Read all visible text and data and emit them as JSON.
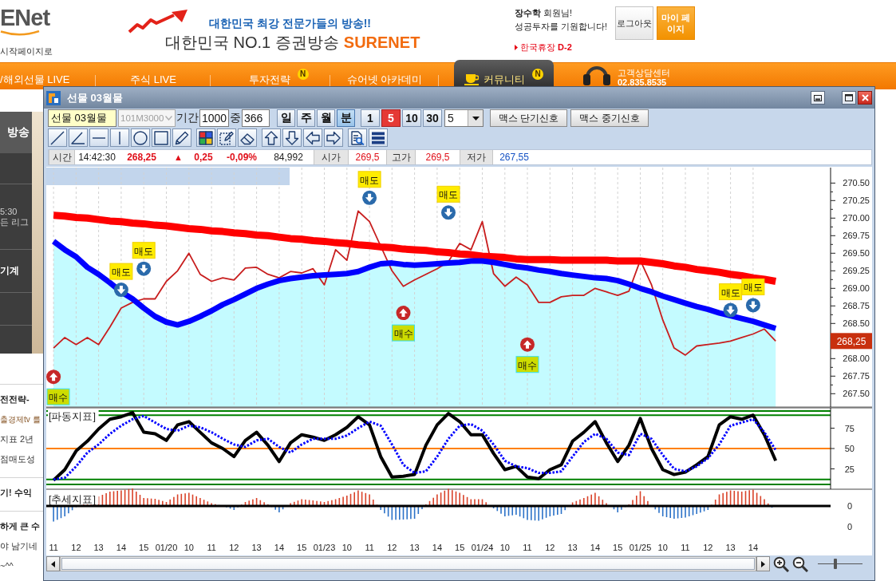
{
  "header": {
    "logo": "ENet",
    "start_page_link": "시작페이지로",
    "tagline": "대한민국 최강 전문가들의 방송!!",
    "title": "대한민국 NO.1 증권방송",
    "brand": "SURENET",
    "greeting": "**장수학** 회원님!",
    "wish": "성공투자를 기원합니다!",
    "notice": "한국휴장 **D-2**",
    "logout_button": "로그아웃",
    "mypage_button": "마이 페이지"
  },
  "nav": {
    "items": [
      {
        "label": "/해외선물 LIVE",
        "selected": false
      },
      {
        "label": "주식 LIVE",
        "selected": false
      },
      {
        "label": "투자전략",
        "badge": "N",
        "selected": false
      },
      {
        "label": "슈어넷 아카데미",
        "selected": false
      },
      {
        "label": "커뮤니티",
        "badge": "N",
        "selected": true
      }
    ],
    "support_title": "고객상담센터",
    "support_phone": "02.835.8535"
  },
  "side": {
    "heading": "방송",
    "entries": [
      {
        "kind": "text",
        "lines": [
          "5:30",
          "든 리그"
        ]
      },
      {
        "kind": "title",
        "lines": [
          "기계"
        ]
      }
    ],
    "news": [
      {
        "kind": "title",
        "text": "전전략-"
      },
      {
        "kind": "source",
        "text": "출경제tv 를"
      },
      {
        "kind": "text",
        "text": "지표 2년"
      },
      {
        "kind": "text",
        "text": "점매도성"
      },
      {
        "kind": "title",
        "text": "기! 수익"
      },
      {
        "kind": "title",
        "text": "하게 큰 수"
      },
      {
        "kind": "text",
        "text": "야 남기네"
      },
      {
        "kind": "text",
        "text": "~^^"
      }
    ]
  },
  "chart_window": {
    "title": "선물 03월물",
    "symbol": "선물 03월물",
    "code": "101M3000",
    "code_disabled": true,
    "period_label": "기간",
    "period": "1000",
    "count_label": "중",
    "count": "366",
    "units": [
      {
        "label": "일",
        "selected": false
      },
      {
        "label": "주",
        "selected": false
      },
      {
        "label": "월",
        "selected": false
      },
      {
        "label": "분",
        "selected": true
      }
    ],
    "intervals": [
      {
        "label": "1",
        "selected": false
      },
      {
        "label": "5",
        "selected": true
      },
      {
        "label": "10",
        "selected": false
      },
      {
        "label": "30",
        "selected": false
      }
    ],
    "interval_select": "5",
    "signal_buttons": [
      "맥스 단기신호",
      "맥스 중기신호"
    ],
    "quote": {
      "time_label": "시간",
      "time": "14:42:30",
      "price": "268,25",
      "change_mark": "▲",
      "change": "0,25",
      "change_pct": "-0,09%",
      "volume": "84,992",
      "open_label": "시가",
      "open": "269,5",
      "high_label": "고가",
      "high": "269,5",
      "low_label": "저가",
      "low": "267,55"
    },
    "price_panel": {
      "price_tag": "268,25",
      "shaded_below_last_series": true,
      "chart_data": {
        "type": "line",
        "grid": true,
        "ylim": [
          267.31,
          270.72
        ],
        "yticks": [
          {
            "value": 267.5,
            "label": "267.50"
          },
          {
            "value": 267.75,
            "label": "267.75"
          },
          {
            "value": 268,
            "label": "268.00"
          },
          {
            "value": 268.5,
            "label": "268.50"
          },
          {
            "value": 268.75,
            "label": "268.75"
          },
          {
            "value": 269,
            "label": "269.00"
          },
          {
            "value": 269.25,
            "label": "269.25"
          },
          {
            "value": 269.5,
            "label": "269.50"
          },
          {
            "value": 269.75,
            "label": "269.75"
          },
          {
            "value": 270,
            "label": "270.00"
          },
          {
            "value": 270.25,
            "label": "270.25"
          },
          {
            "value": 270.5,
            "label": "270.50"
          }
        ],
        "series": [
          {
            "color": "#c81e1e",
            "values": [
              268.15,
              268.3,
              268.2,
              268.3,
              268.2,
              268.45,
              268.72,
              268.8,
              268.85,
              268.85,
              269.1,
              269.25,
              269.5,
              269.2,
              269.1,
              269.15,
              269.12,
              269.29,
              269.3,
              269.2,
              269.15,
              269.24,
              269.22,
              269.28,
              269.05,
              269.55,
              269.4,
              270.1,
              269.95,
              269.6,
              269.25,
              269.03,
              269.12,
              269.2,
              269.28,
              269.38,
              269.64,
              269.55,
              269.95,
              269.21,
              269.03,
              269.16,
              269.05,
              268.8,
              268.8,
              268.88,
              268.9,
              268.9,
              269.0,
              268.95,
              268.9,
              268.96,
              269.4,
              269.05,
              268.55,
              268.15,
              268.05,
              268.18,
              268.2,
              268.22,
              268.25,
              268.3,
              268.35,
              268.42,
              268.25
            ]
          },
          {
            "name": "매수",
            "type": "scatter",
            "color": "#c62828",
            "values": [
              267.74,
              null,
              null,
              null,
              null,
              null,
              null,
              null,
              null,
              null,
              null,
              null,
              null,
              null,
              null,
              null,
              null,
              null,
              null,
              null,
              null,
              null,
              null,
              null,
              null,
              null,
              null,
              null,
              null,
              null,
              null,
              268.65,
              null,
              null,
              null,
              null,
              null,
              null,
              null,
              null,
              null,
              null,
              268.2,
              null,
              null,
              null,
              null,
              null,
              null,
              null,
              null,
              null,
              null,
              null,
              null,
              null,
              null,
              null,
              null,
              null,
              null,
              null,
              null,
              null,
              null
            ]
          },
          {
            "name": "매도",
            "type": "scatter",
            "color": "#2a6aab",
            "values": [
              null,
              null,
              null,
              null,
              null,
              null,
              268.98,
              null,
              269.28,
              null,
              null,
              null,
              null,
              null,
              null,
              null,
              null,
              null,
              null,
              null,
              null,
              null,
              null,
              null,
              null,
              null,
              null,
              null,
              270.29,
              null,
              null,
              null,
              null,
              null,
              null,
              270.08,
              null,
              null,
              null,
              null,
              null,
              null,
              null,
              null,
              null,
              null,
              null,
              null,
              null,
              null,
              null,
              null,
              null,
              null,
              null,
              null,
              null,
              null,
              null,
              null,
              268.69,
              null,
              268.76,
              null,
              null
            ]
          },
          {
            "color": "#ff0000",
            "values": [
              270.04,
              270.03,
              270.01,
              270.0,
              269.98,
              269.96,
              269.95,
              269.93,
              269.92,
              269.9,
              269.89,
              269.87,
              269.85,
              269.84,
              269.82,
              269.81,
              269.79,
              269.78,
              269.76,
              269.75,
              269.73,
              269.71,
              269.7,
              269.68,
              269.67,
              269.65,
              269.64,
              269.62,
              269.61,
              269.59,
              269.58,
              269.56,
              269.55,
              269.54,
              269.52,
              269.51,
              269.49,
              269.48,
              269.46,
              269.45,
              269.44,
              269.42,
              269.41,
              269.41,
              269.41,
              269.4,
              269.4,
              269.4,
              269.4,
              269.4,
              269.39,
              269.39,
              269.39,
              269.37,
              269.35,
              269.32,
              269.3,
              269.27,
              269.25,
              269.23,
              269.2,
              269.18,
              269.15,
              269.13,
              269.1
            ]
          },
          {
            "color": "#0000ff",
            "values": [
              269.67,
              269.55,
              269.45,
              269.3,
              269.2,
              269.08,
              268.95,
              268.85,
              268.72,
              268.6,
              268.52,
              268.48,
              268.53,
              268.6,
              268.68,
              268.77,
              268.84,
              268.92,
              269.0,
              269.06,
              269.11,
              269.14,
              269.16,
              269.18,
              269.19,
              269.2,
              269.21,
              269.24,
              269.3,
              269.35,
              269.36,
              269.34,
              269.33,
              269.34,
              269.35,
              269.36,
              269.37,
              269.39,
              269.39,
              269.37,
              269.34,
              269.31,
              269.29,
              269.26,
              269.24,
              269.21,
              269.19,
              269.17,
              269.15,
              269.14,
              269.11,
              269.06,
              269.0,
              268.95,
              268.89,
              268.84,
              268.79,
              268.74,
              268.7,
              268.65,
              268.61,
              268.57,
              268.53,
              268.48,
              268.43
            ]
          }
        ]
      }
    },
    "oscillator_panel": {
      "title": "[파동지표]",
      "chart_data": {
        "type": "line",
        "ylim": [
          0,
          100
        ],
        "yticks": [
          25,
          50,
          75
        ],
        "series": [
          {
            "color": "#000000",
            "values": [
              11,
              24,
              47,
              59,
              74,
              86,
              89,
              94,
              70,
              68,
              60,
              79,
              83,
              70,
              57,
              50,
              40,
              60,
              70,
              54,
              34,
              57,
              67,
              64,
              60,
              67,
              76,
              89,
              79,
              40,
              15,
              16,
              18,
              54,
              79,
              93,
              83,
              67,
              67,
              44,
              24,
              28,
              15,
              13,
              24,
              30,
              59,
              70,
              83,
              57,
              34,
              54,
              87,
              50,
              24,
              18,
              21,
              30,
              40,
              79,
              89,
              86,
              91,
              67,
              35
            ]
          },
          {
            "color": "#0000ff",
            "line_style": "dotted",
            "values": [
              12,
              14,
              28,
              45,
              55,
              68,
              78,
              86,
              90,
              82,
              74,
              72,
              78,
              76,
              70,
              62,
              55,
              52,
              60,
              62,
              52,
              45,
              55,
              62,
              62,
              62,
              66,
              75,
              83,
              78,
              55,
              30,
              20,
              22,
              40,
              62,
              78,
              80,
              72,
              55,
              35,
              28,
              26,
              20,
              20,
              22,
              40,
              58,
              68,
              62,
              45,
              42,
              68,
              62,
              42,
              25,
              22,
              28,
              38,
              55,
              78,
              82,
              86,
              70,
              48
            ]
          }
        ],
        "ref_lines": [
          {
            "axis": "y",
            "value": 96,
            "color": "#008000"
          },
          {
            "axis": "y",
            "value": 91,
            "color": "#008000"
          },
          {
            "axis": "y",
            "value": 50,
            "color": "#ff8000"
          },
          {
            "axis": "y",
            "value": 12,
            "color": "#008000"
          },
          {
            "axis": "y",
            "value": 6,
            "color": "#008000"
          }
        ]
      }
    },
    "trend_panel": {
      "title": "[추세지표]",
      "axis_labels": [
        "0",
        "0"
      ]
    },
    "time_axis": {
      "labels": [
        "11",
        "12",
        "13",
        "14",
        "15",
        "01/20",
        "10",
        "11",
        "12",
        "13",
        "14",
        "15",
        "01/23",
        "10",
        "11",
        "12",
        "13",
        "14",
        "15",
        "01/24",
        "10",
        "11",
        "12",
        "13",
        "14",
        "15",
        "01/25",
        "10",
        "11",
        "12",
        "13",
        "14"
      ]
    },
    "zoom_slider": {
      "level": 0.4
    }
  }
}
